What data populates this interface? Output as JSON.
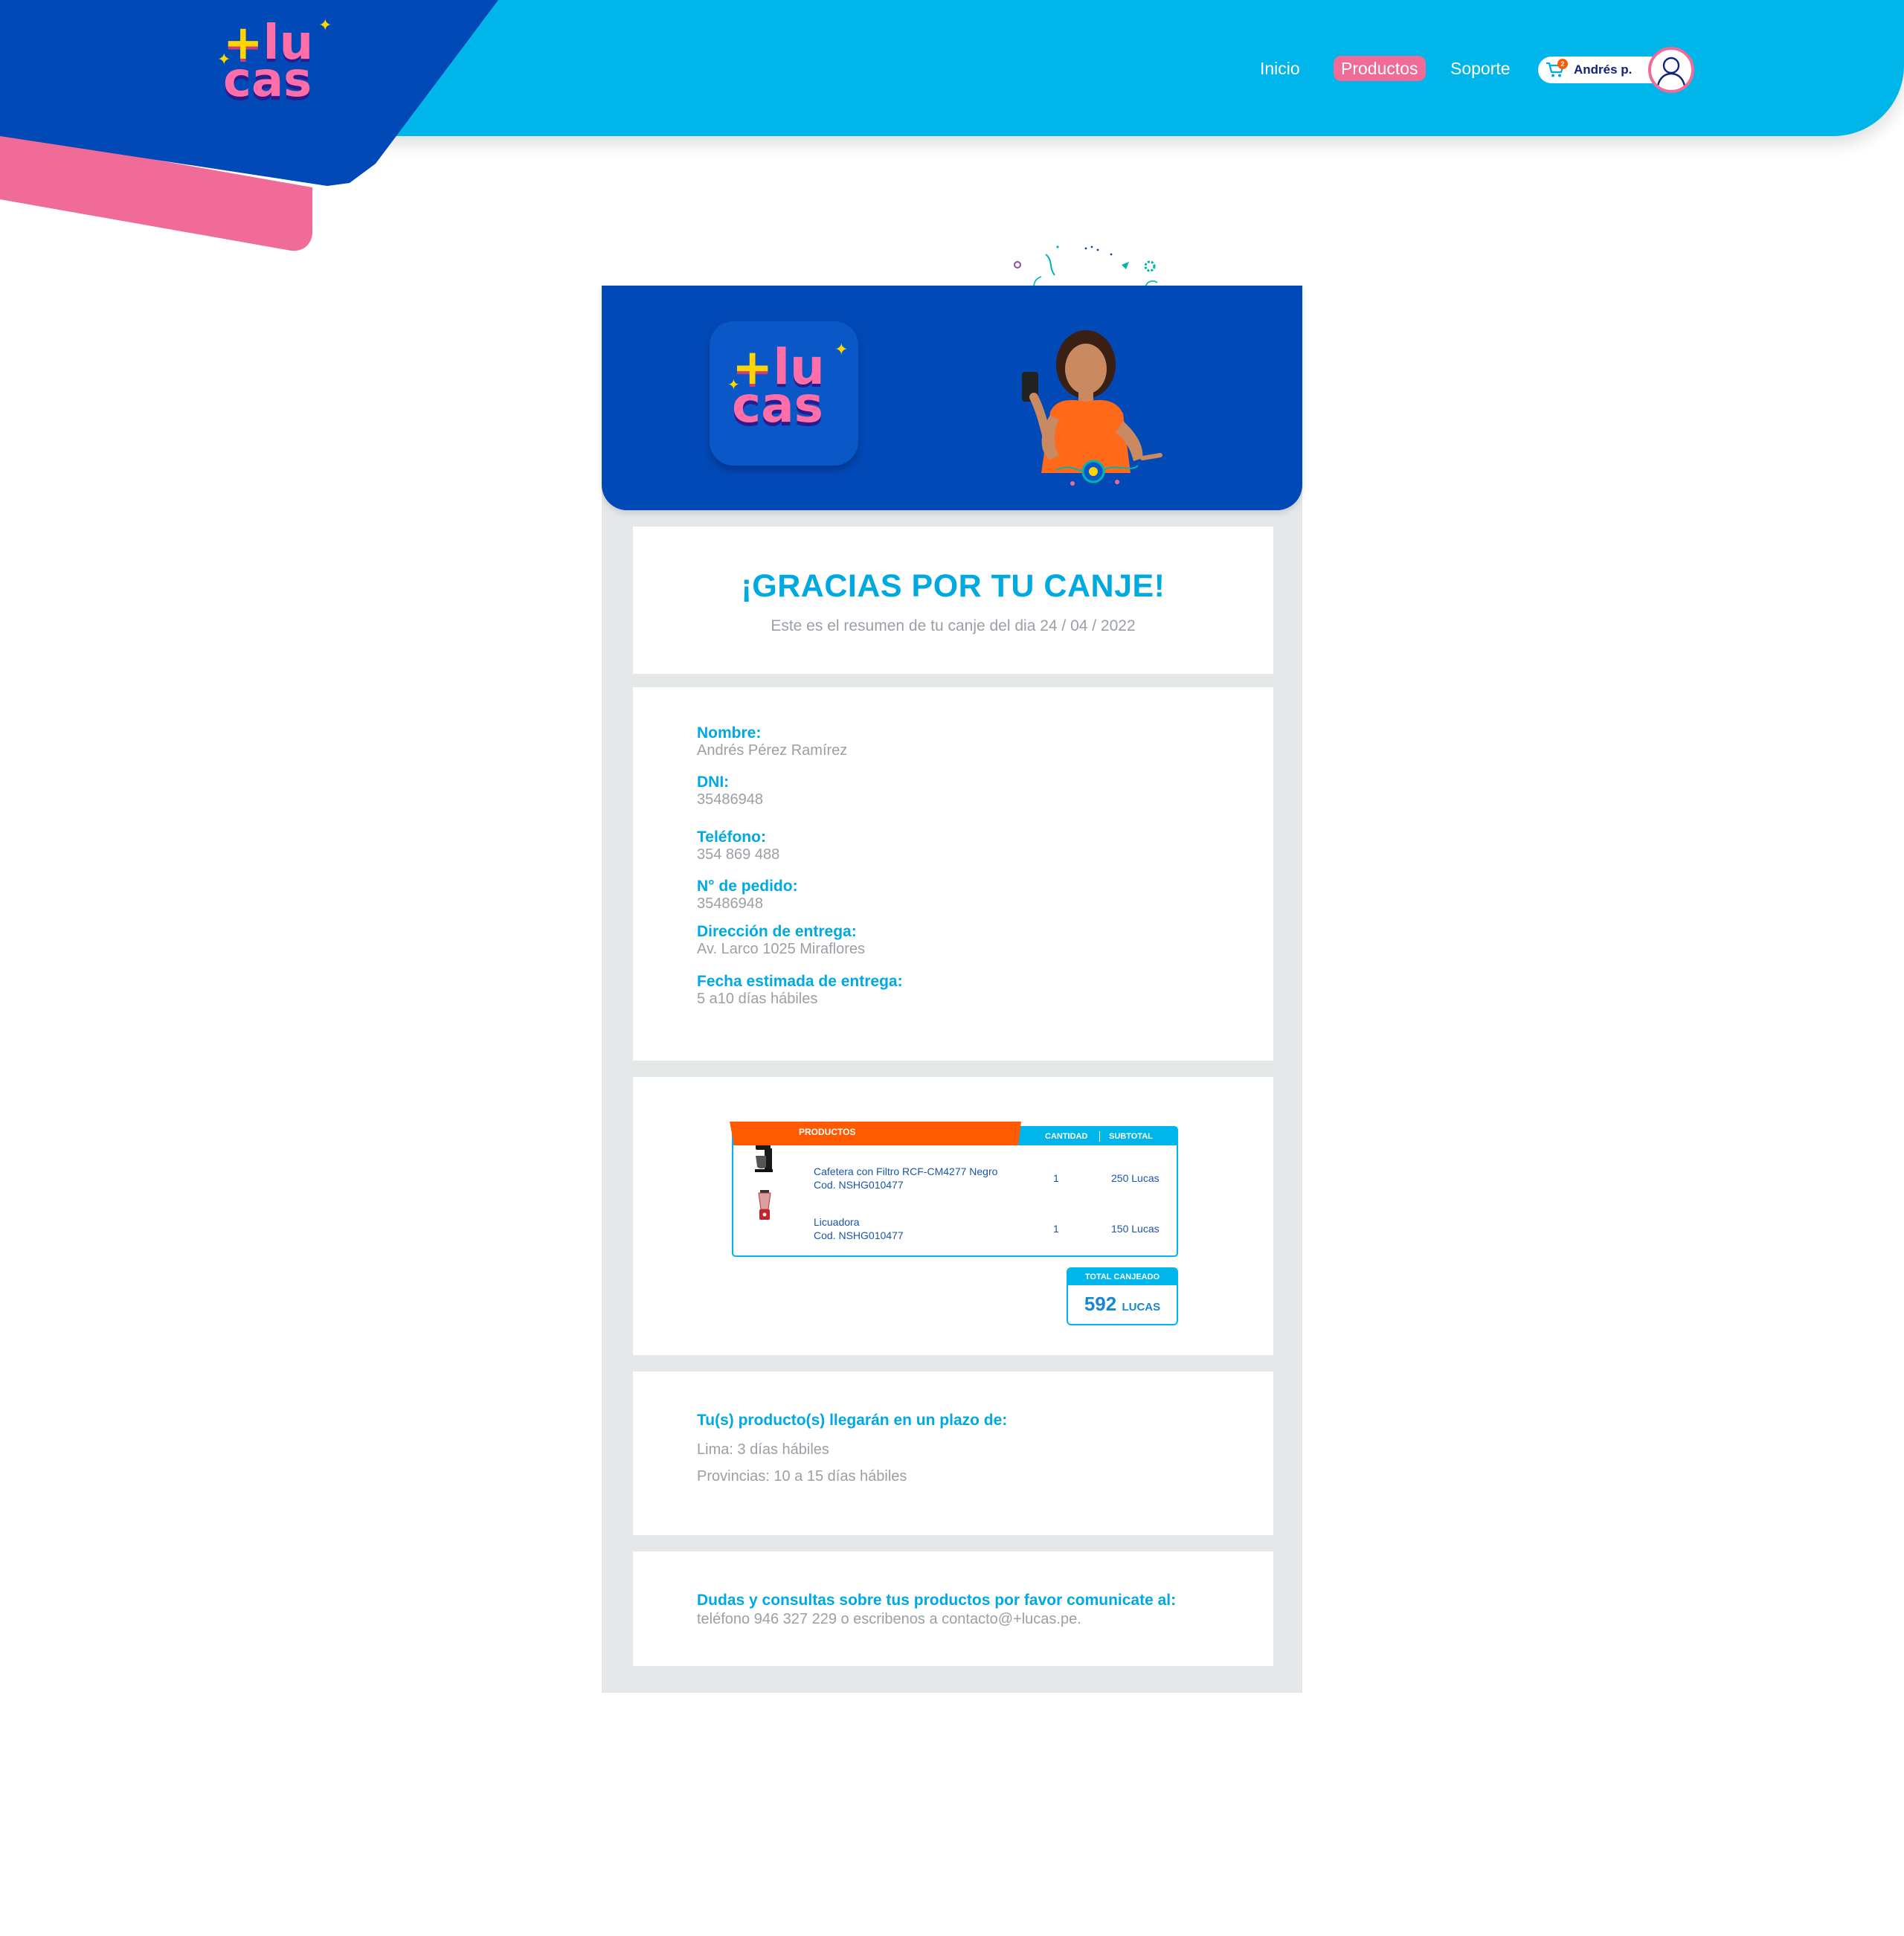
{
  "header": {
    "logo_plus": "+",
    "logo_lu": "lu",
    "logo_cas": "cas",
    "nav": [
      {
        "label": "Inicio"
      },
      {
        "label": "Productos"
      },
      {
        "label": "Soporte"
      }
    ],
    "cart_count": "2",
    "user_name": "Andrés p."
  },
  "thanks": {
    "title": "¡GRACIAS POR TU CANJE!",
    "subtitle": "Este es el resumen de tu canje del dia 24 / 04 / 2022"
  },
  "customer": {
    "fields": [
      {
        "label": "Nombre:",
        "value": "Andrés Pérez Ramírez"
      },
      {
        "label": "DNI:",
        "value": "35486948"
      },
      {
        "label": "Teléfono:",
        "value": "354 869 488"
      },
      {
        "label": "N° de pedido:",
        "value": "35486948"
      },
      {
        "label": "Dirección de entrega:",
        "value": "Av. Larco 1025 Miraflores"
      },
      {
        "label": "Fecha estimada de entrega:",
        "value": "5 a10 días hábiles"
      }
    ]
  },
  "order": {
    "col_products": "PRODUCTOS",
    "col_quantity": "CANTIDAD",
    "col_subtotal": "SUBTOTAL",
    "rows": [
      {
        "name": "Cafetera con Filtro RCF-CM4277 Negro",
        "code": "Cod. NSHG010477",
        "qty": "1",
        "subtotal": "250 Lucas"
      },
      {
        "name": "Licuadora",
        "code": "Cod. NSHG010477",
        "qty": "1",
        "subtotal": "150 Lucas"
      }
    ],
    "total_label": "TOTAL CANJEADO",
    "total_value": "592",
    "total_unit": "LUCAS"
  },
  "delivery": {
    "title": "Tu(s)  producto(s) llegarán en un plazo de:",
    "lima": "Lima: 3 días hábiles",
    "provincias": "Provincias: 10 a 15  días hábiles"
  },
  "contact": {
    "title": "Dudas y consultas sobre tus productos por favor comunicate al:",
    "text": "teléfono 946 327 229 o escribenos a contacto@+lucas.pe."
  },
  "colors": {
    "brand_blue": "#0249b8",
    "sky_blue": "#00b5ea",
    "pink": "#f06b97",
    "orange": "#ff5a00",
    "gray_bg": "#e4e8e9"
  }
}
